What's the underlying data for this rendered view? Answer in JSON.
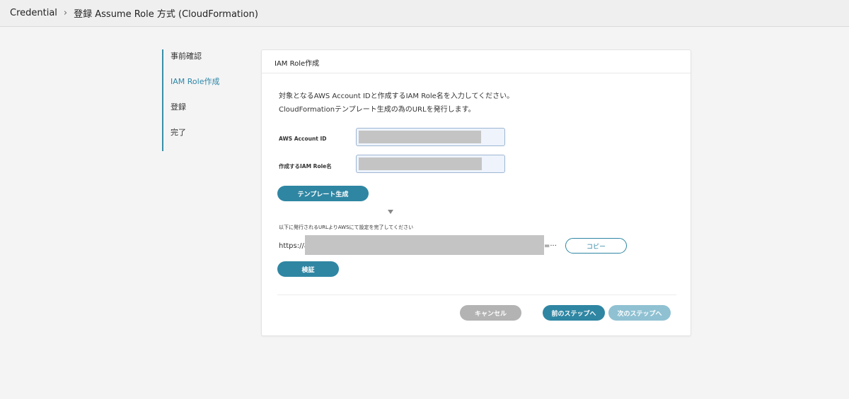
{
  "breadcrumb": {
    "root": "Credential",
    "separator": "›",
    "current": "登録 Assume Role 方式 (CloudFormation)"
  },
  "steps": [
    {
      "label": "事前確認",
      "active": false
    },
    {
      "label": "IAM Role作成",
      "active": true
    },
    {
      "label": "登録",
      "active": false
    },
    {
      "label": "完了",
      "active": false
    }
  ],
  "card": {
    "title": "IAM Role作成",
    "intro_line1": "対象となるAWS Account IDと作成するIAM Role名を入力してください。",
    "intro_line2": "CloudFormationテンプレート生成の為のURLを発行します。",
    "account_id_label": "AWS Account ID",
    "role_name_label": "作成するIAM Role名",
    "generate_button": "テンプレート生成",
    "url_note": "以下に発行されるURLよりAWSにて設定を完了してください",
    "url_prefix": "https://a",
    "url_suffix": "=···",
    "copy_button": "コピー",
    "verify_button": "検証",
    "cancel_button": "キャンセル",
    "prev_button": "前のステップへ",
    "next_button": "次のステップへ"
  },
  "colors": {
    "accent": "#2f86a3",
    "disabled": "#8fc1d2",
    "cancel": "#b3b3b3"
  }
}
